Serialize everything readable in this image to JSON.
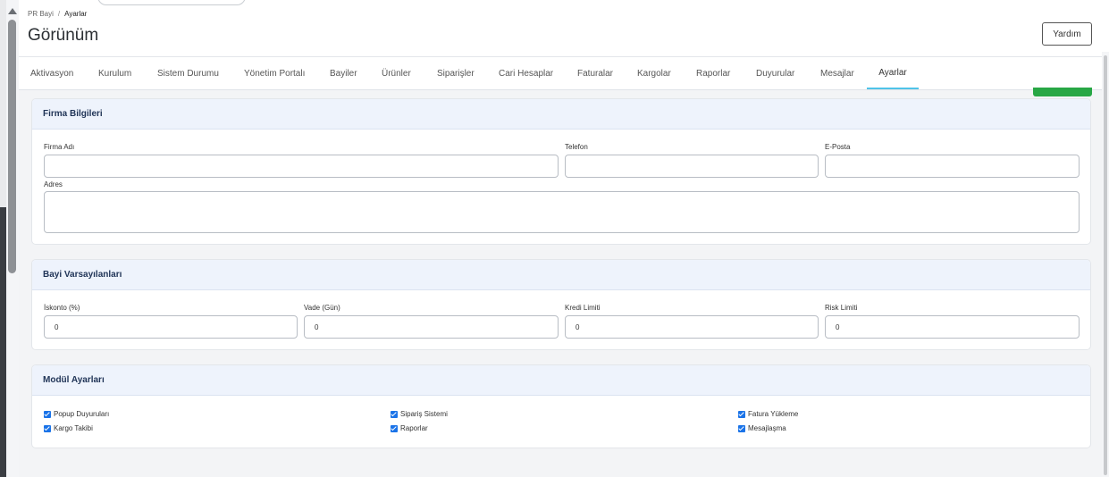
{
  "breadcrumb": {
    "root": "PR Bayi",
    "separator": "/",
    "current": "Ayarlar"
  },
  "page": {
    "title": "Görünüm",
    "help_label": "Yardım"
  },
  "tabs": [
    {
      "label": "Aktivasyon"
    },
    {
      "label": "Kurulum"
    },
    {
      "label": "Sistem Durumu"
    },
    {
      "label": "Yönetim Portalı"
    },
    {
      "label": "Bayiler"
    },
    {
      "label": "Ürünler"
    },
    {
      "label": "Siparişler"
    },
    {
      "label": "Cari Hesaplar"
    },
    {
      "label": "Faturalar"
    },
    {
      "label": "Kargolar"
    },
    {
      "label": "Raporlar"
    },
    {
      "label": "Duyurular"
    },
    {
      "label": "Mesajlar"
    },
    {
      "label": "Ayarlar",
      "active": true
    }
  ],
  "firma": {
    "title": "Firma Bilgileri",
    "firma_adi_label": "Firma Adı",
    "firma_adi_value": "",
    "telefon_label": "Telefon",
    "telefon_value": "",
    "eposta_label": "E-Posta",
    "eposta_value": "",
    "adres_label": "Adres",
    "adres_value": ""
  },
  "bayi": {
    "title": "Bayi Varsayılanları",
    "iskonto_label": "İskonto (%)",
    "iskonto_value": "0",
    "vade_label": "Vade (Gün)",
    "vade_value": "0",
    "kredi_label": "Kredi Limiti",
    "kredi_value": "0",
    "risk_label": "Risk Limiti",
    "risk_value": "0"
  },
  "modul": {
    "title": "Modül Ayarları",
    "options": [
      {
        "label": "Popup Duyuruları",
        "checked": true
      },
      {
        "label": "Sipariş Sistemi",
        "checked": true
      },
      {
        "label": "Fatura Yükleme",
        "checked": true
      },
      {
        "label": "Kargo Takibi",
        "checked": true
      },
      {
        "label": "Raporlar",
        "checked": true
      },
      {
        "label": "Mesajlaşma",
        "checked": true
      }
    ]
  },
  "colors": {
    "accent_tab": "#4fc3e8",
    "card_header_bg": "#eef3fc",
    "card_title": "#1f3356",
    "checkbox": "#1a73e8",
    "save_green": "#28a745"
  }
}
